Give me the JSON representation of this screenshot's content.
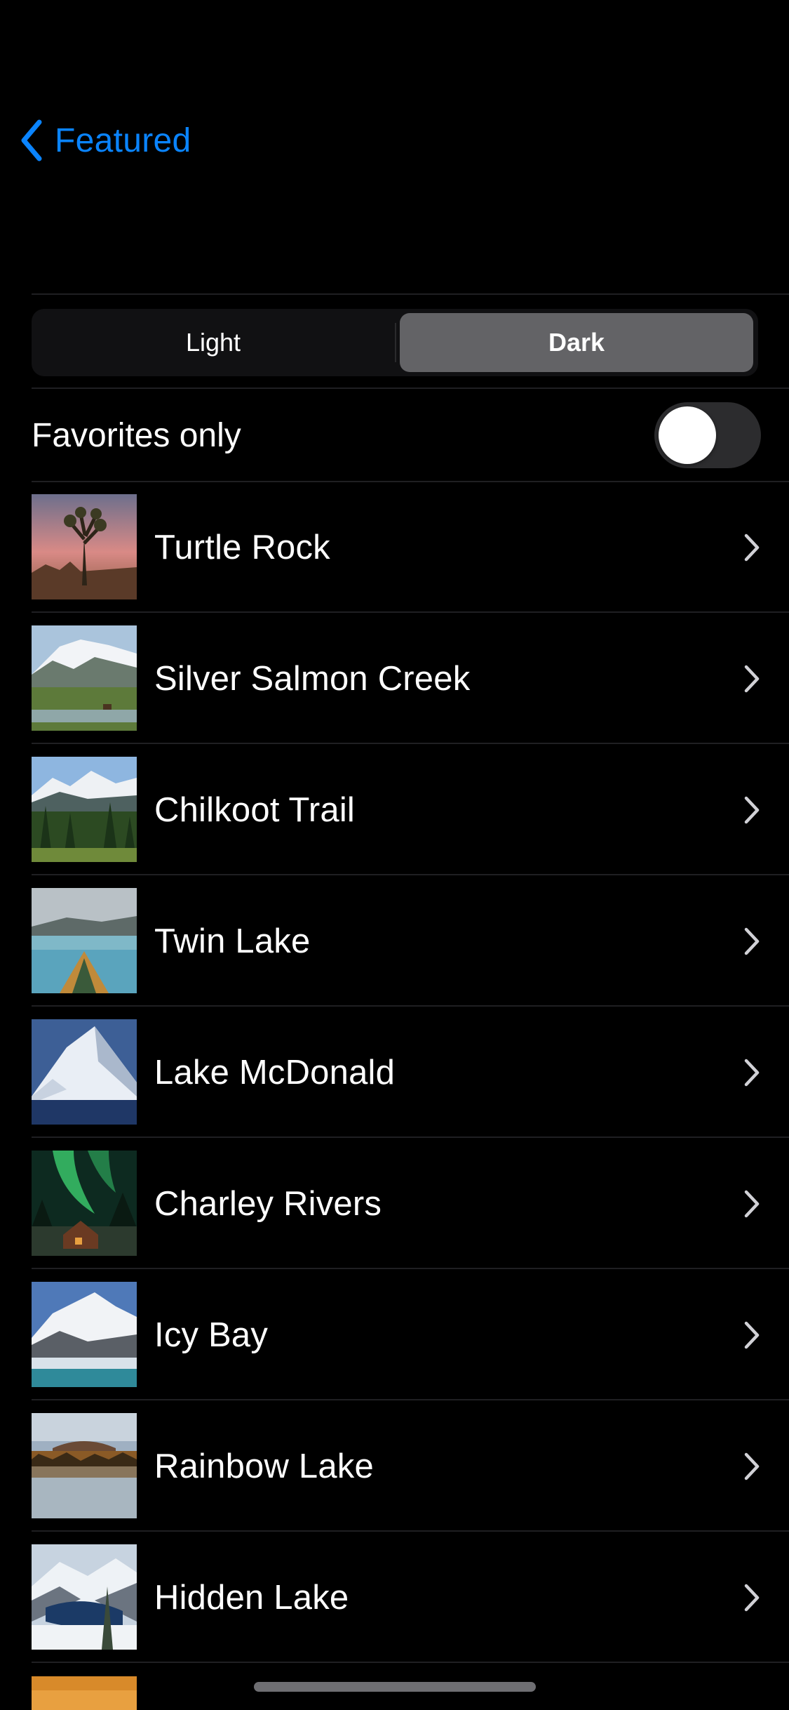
{
  "nav": {
    "back_label": "Featured",
    "back_icon": "chevron-left-icon",
    "accent_color": "#0a84ff"
  },
  "appearance": {
    "options": [
      "Light",
      "Dark"
    ],
    "selected": "Dark"
  },
  "favorites": {
    "label": "Favorites only",
    "enabled": false
  },
  "landmarks": [
    {
      "name": "Turtle Rock"
    },
    {
      "name": "Silver Salmon Creek"
    },
    {
      "name": "Chilkoot Trail"
    },
    {
      "name": "Twin Lake"
    },
    {
      "name": "Lake McDonald"
    },
    {
      "name": "Charley Rivers"
    },
    {
      "name": "Icy Bay"
    },
    {
      "name": "Rainbow Lake"
    },
    {
      "name": "Hidden Lake"
    }
  ]
}
